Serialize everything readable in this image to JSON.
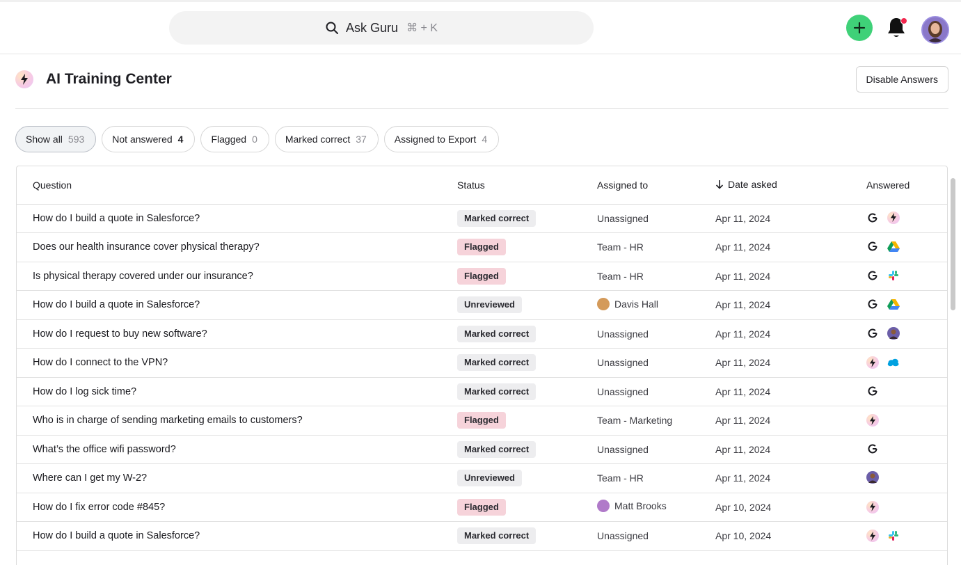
{
  "topbar": {
    "search_label": "Ask Guru",
    "search_shortcut": "⌘ + K"
  },
  "header": {
    "title": "AI Training Center",
    "disable_button": "Disable Answers"
  },
  "filters": [
    {
      "label": "Show all",
      "count": "593"
    },
    {
      "label": "Not answered",
      "count": "4"
    },
    {
      "label": "Flagged",
      "count": "0"
    },
    {
      "label": "Marked correct",
      "count": "37"
    },
    {
      "label": "Assigned to Export",
      "count": "4"
    }
  ],
  "table": {
    "columns": {
      "question": "Question",
      "status": "Status",
      "assigned": "Assigned to",
      "date": "Date asked",
      "answered": "Answered"
    },
    "rows": [
      {
        "question": "How do I build a quote in Salesforce?",
        "status": "Marked correct",
        "assigned": "Unassigned",
        "date": "Apr 11, 2024",
        "sources": [
          "google-icon",
          "guru-icon"
        ]
      },
      {
        "question": "Does our health insurance cover physical therapy?",
        "status": "Flagged",
        "assigned": "Team - HR",
        "date": "Apr 11, 2024",
        "sources": [
          "google-icon",
          "google-drive-icon"
        ]
      },
      {
        "question": "Is physical therapy covered under our insurance?",
        "status": "Flagged",
        "assigned": "Team - HR",
        "date": "Apr 11, 2024",
        "sources": [
          "google-icon",
          "slack-icon"
        ]
      },
      {
        "question": "How do I build a quote in Salesforce?",
        "status": "Unreviewed",
        "assigned": "Davis Hall",
        "date": "Apr 11, 2024",
        "sources": [
          "google-icon",
          "google-drive-icon"
        ]
      },
      {
        "question": "How do I request to buy new software?",
        "status": "Marked correct",
        "assigned": "Unassigned",
        "date": "Apr 11, 2024",
        "sources": [
          "google-icon",
          "person-icon"
        ]
      },
      {
        "question": "How do I connect to the VPN?",
        "status": "Marked correct",
        "assigned": "Unassigned",
        "date": "Apr 11, 2024",
        "sources": [
          "guru-icon",
          "salesforce-icon"
        ]
      },
      {
        "question": "How do I log sick time?",
        "status": "Marked correct",
        "assigned": "Unassigned",
        "date": "Apr 11, 2024",
        "sources": [
          "google-icon"
        ]
      },
      {
        "question": "Who is in charge of sending marketing emails to customers?",
        "status": "Flagged",
        "assigned": "Team - Marketing",
        "date": "Apr 11, 2024",
        "sources": [
          "guru-icon"
        ]
      },
      {
        "question": "What’s the office wifi password?",
        "status": "Marked correct",
        "assigned": "Unassigned",
        "date": "Apr 11, 2024",
        "sources": [
          "google-icon"
        ]
      },
      {
        "question": "Where can I get my W-2?",
        "status": "Unreviewed",
        "assigned": "Team - HR",
        "date": "Apr 11, 2024",
        "sources": [
          "person-icon"
        ]
      },
      {
        "question": "How do I fix error code #845?",
        "status": "Flagged",
        "assigned": "Matt Brooks",
        "date": "Apr 10, 2024",
        "sources": [
          "guru-icon"
        ]
      },
      {
        "question": "How do I build a quote in Salesforce?",
        "status": "Marked correct",
        "assigned": "Unassigned",
        "date": "Apr 10, 2024",
        "sources": [
          "guru-icon",
          "slack-icon"
        ]
      }
    ]
  },
  "colors": {
    "add_button": "#3fd178",
    "notification_dot": "#f2274e",
    "flagged_badge": "#f6d3da",
    "neutral_badge": "#ededef"
  }
}
